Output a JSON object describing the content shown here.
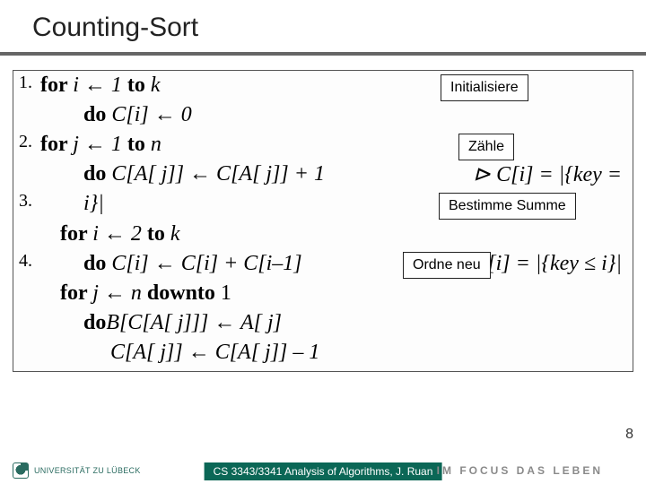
{
  "title": "Counting-Sort",
  "labels": {
    "init": "Initialisiere",
    "count": "Zähle",
    "sum": "Bestimme Summe",
    "reorder": "Ordne neu"
  },
  "algo": {
    "n1": "1.",
    "n2": "2.",
    "n3": "3.",
    "n4": "4.",
    "l1a": "for ",
    "l1b": "i ← 1 ",
    "l1c": "to ",
    "l1d": "k",
    "l2a": "do ",
    "l2b": "C[i] ← 0",
    "l3a": "for ",
    "l3b": "j ← 1 ",
    "l3c": "to ",
    "l3d": "n",
    "l4a": "do ",
    "l4b": "C[A[ j]] ← C[A[ j]] + 1",
    "l4c": "⊳ C[i] = |{key = ",
    "l5a": "i}|",
    "l6a": "for ",
    "l6b": "i ← 2 ",
    "l6c": "to ",
    "l6d": "k",
    "l7a": "do ",
    "l7b": "C[i] ← C[i] + C[i–1]",
    "l7c": "⊳ C[i] = |{key ≤ i}|",
    "l8a": "for ",
    "l8b": "j ← n ",
    "l8c": "downto ",
    "l8d": "1",
    "l9a": "do",
    "l9b": "B[C[A[ j]]] ← A[ j]",
    "l10a": "C[A[ j]] ← C[A[ j]] – 1"
  },
  "footer": {
    "left": "UNIVERSITÄT ZU LÜBECK",
    "center": "CS 3343/3341 Analysis of Algorithms, J. Ruan",
    "right": "IM FOCUS DAS LEBEN"
  },
  "page": "8"
}
